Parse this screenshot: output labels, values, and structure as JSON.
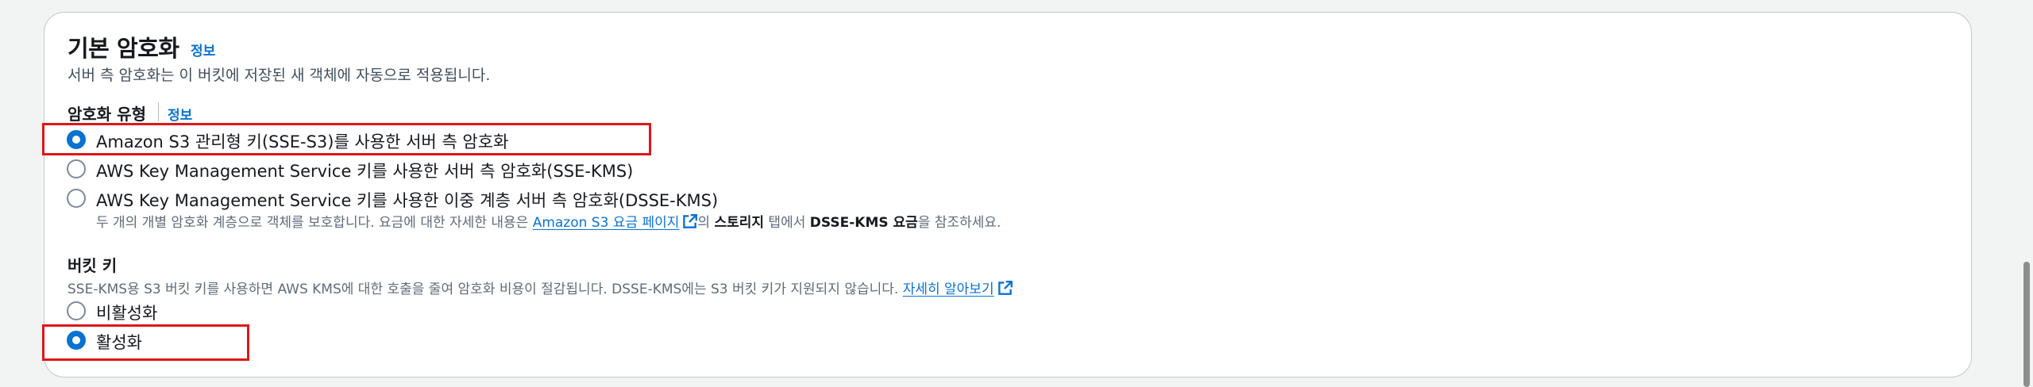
{
  "section": {
    "title": "기본 암호화",
    "info": "정보",
    "description": "서버 측 암호화는 이 버킷에 저장된 새 객체에 자동으로 적용됩니다."
  },
  "encryption_type": {
    "label": "암호화 유형",
    "info": "정보",
    "options": [
      {
        "label": "Amazon S3 관리형 키(SSE-S3)를 사용한 서버 측 암호화",
        "selected": true
      },
      {
        "label": "AWS Key Management Service 키를 사용한 서버 측 암호화(SSE-KMS)",
        "selected": false
      },
      {
        "label": "AWS Key Management Service 키를 사용한 이중 계층 서버 측 암호화(DSSE-KMS)",
        "selected": false
      }
    ],
    "dsse_note": {
      "prefix": "두 개의 개별 암호화 계층으로 객체를 보호합니다. 요금에 대한 자세한 내용은 ",
      "link": "Amazon S3 요금 페이지",
      "mid1": "의 ",
      "bold1": "스토리지",
      "mid2": " 탭에서 ",
      "bold2": "DSSE-KMS 요금",
      "suffix": "을 참조하세요."
    }
  },
  "bucket_key": {
    "label": "버킷 키",
    "description": "SSE-KMS용 S3 버킷 키를 사용하면 AWS KMS에 대한 호출을 줄여 암호화 비용이 절감됩니다. DSSE-KMS에는 S3 버킷 키가 지원되지 않습니다.",
    "learn_more": "자세히 알아보기",
    "options": [
      {
        "label": "비활성화",
        "selected": false
      },
      {
        "label": "활성화",
        "selected": true
      }
    ]
  },
  "colors": {
    "accent": "#0972d3",
    "highlight": "#e0151a",
    "text": "#16191f",
    "muted": "#5f6b7a"
  }
}
